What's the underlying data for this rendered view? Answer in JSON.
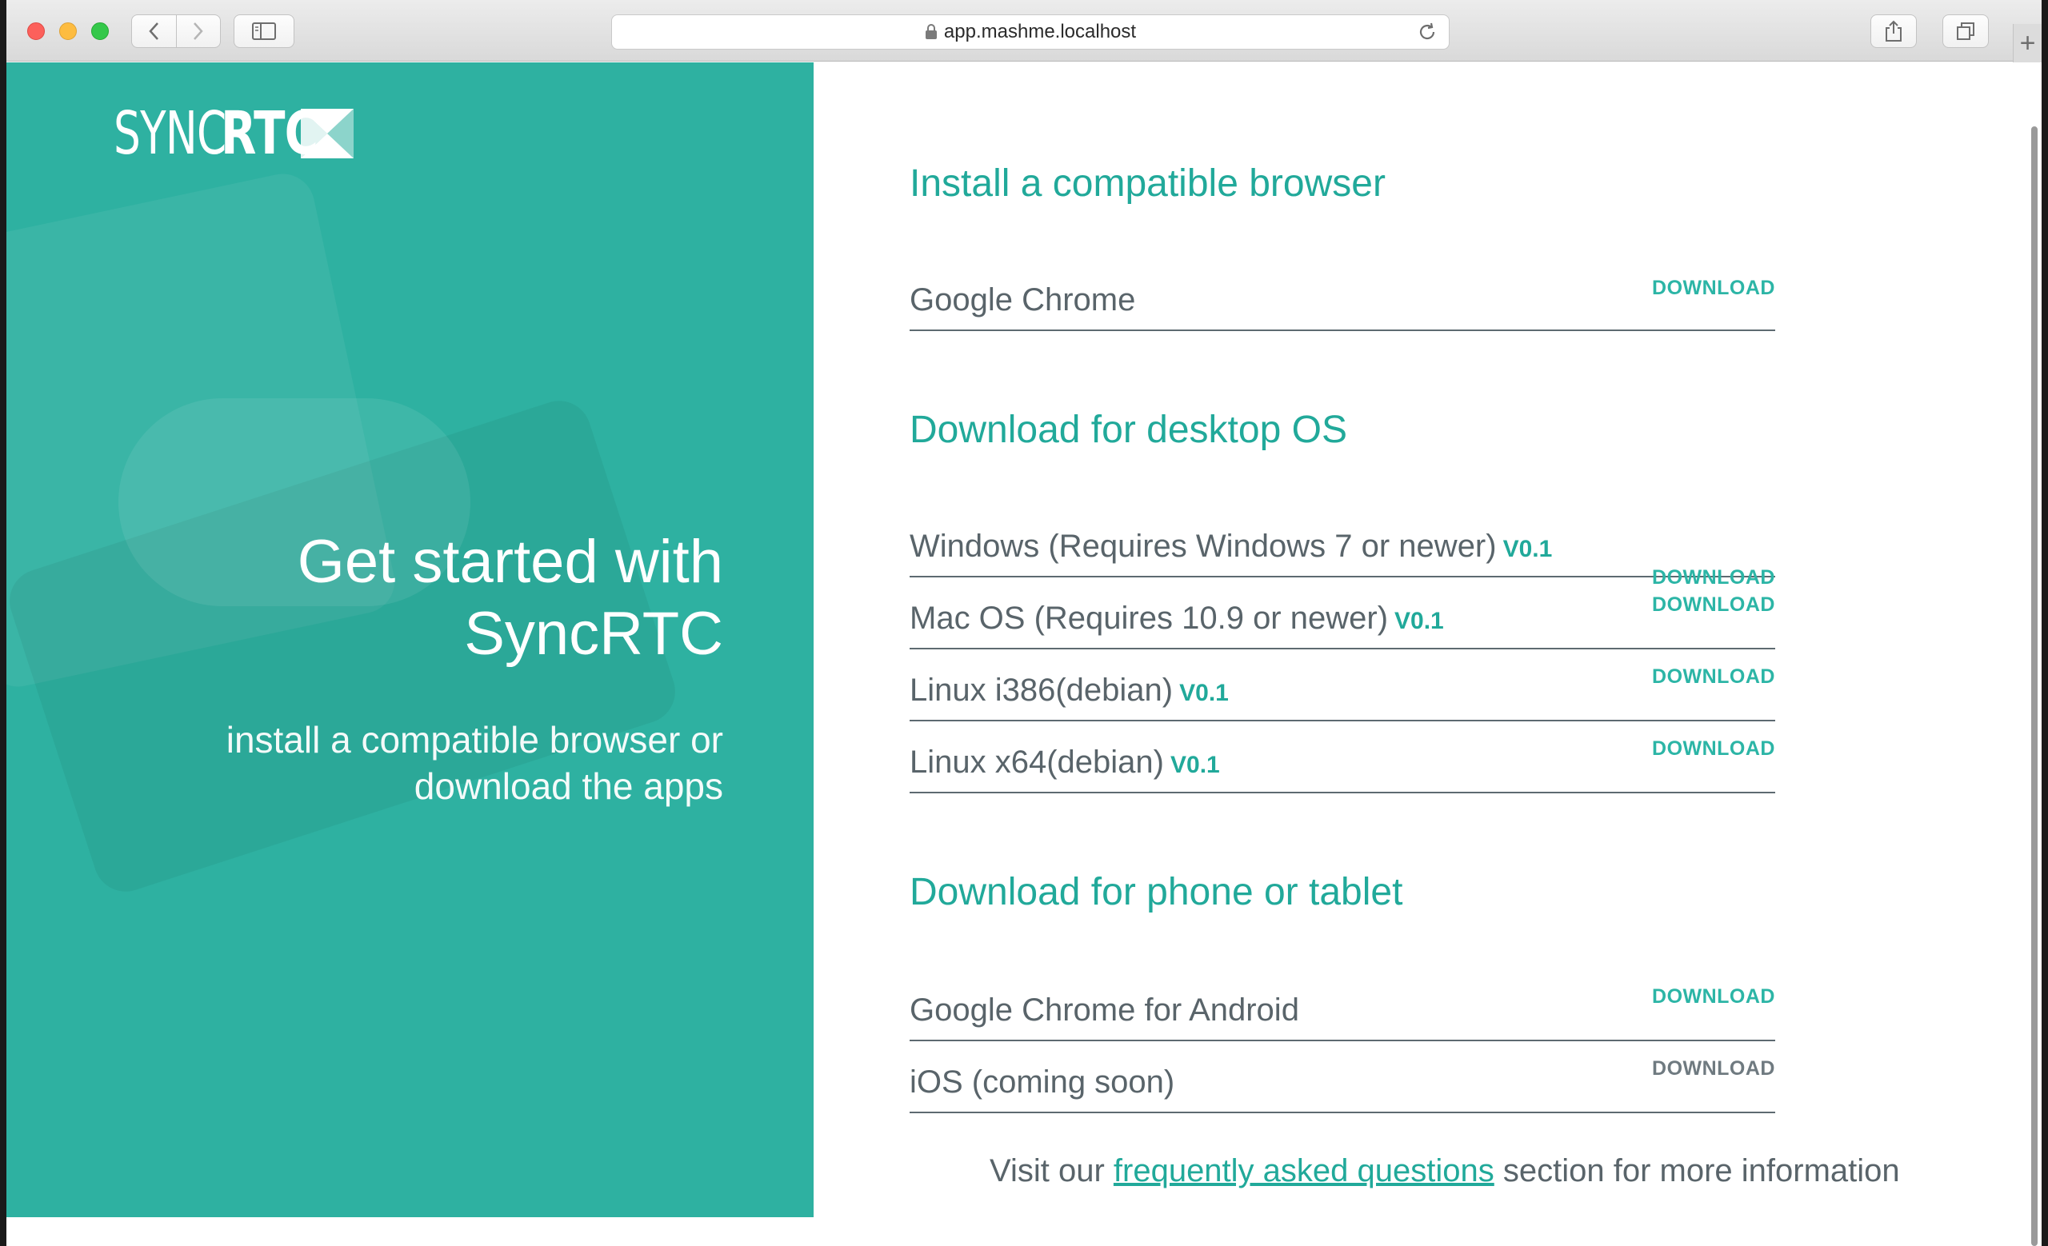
{
  "browser": {
    "url": "app.mashme.localhost"
  },
  "brand": {
    "logo_thin": "SYNC",
    "logo_bold": "RTC"
  },
  "hero": {
    "title_line1": "Get started with",
    "title_line2": "SyncRTC",
    "subtitle_line1": "install a compatible browser or",
    "subtitle_line2": "download the apps"
  },
  "sections": {
    "browser": {
      "title": "Install a compatible browser",
      "items": [
        {
          "label": "Google Chrome",
          "version": "",
          "action": "DOWNLOAD"
        }
      ]
    },
    "desktop": {
      "title": "Download for desktop OS",
      "items": [
        {
          "label": "Windows (Requires Windows 7 or newer)",
          "version": "V0.1",
          "action": "DOWNLOAD"
        },
        {
          "label": "Mac OS (Requires 10.9 or newer)",
          "version": "V0.1",
          "action": "DOWNLOAD"
        },
        {
          "label": "Linux i386(debian)",
          "version": "V0.1",
          "action": "DOWNLOAD"
        },
        {
          "label": "Linux x64(debian)",
          "version": "V0.1",
          "action": "DOWNLOAD"
        }
      ]
    },
    "mobile": {
      "title": "Download for phone or tablet",
      "items": [
        {
          "label": "Google Chrome for Android",
          "version": "",
          "action": "DOWNLOAD"
        },
        {
          "label": "iOS (coming soon)",
          "version": "",
          "action": "DOWNLOAD"
        }
      ]
    }
  },
  "faq": {
    "prefix": "Visit our ",
    "link": "frequently asked questions",
    "suffix": " section for more information"
  },
  "colors": {
    "accent": "#21a99a",
    "panel": "#2eb1a1",
    "text": "#59646a"
  }
}
